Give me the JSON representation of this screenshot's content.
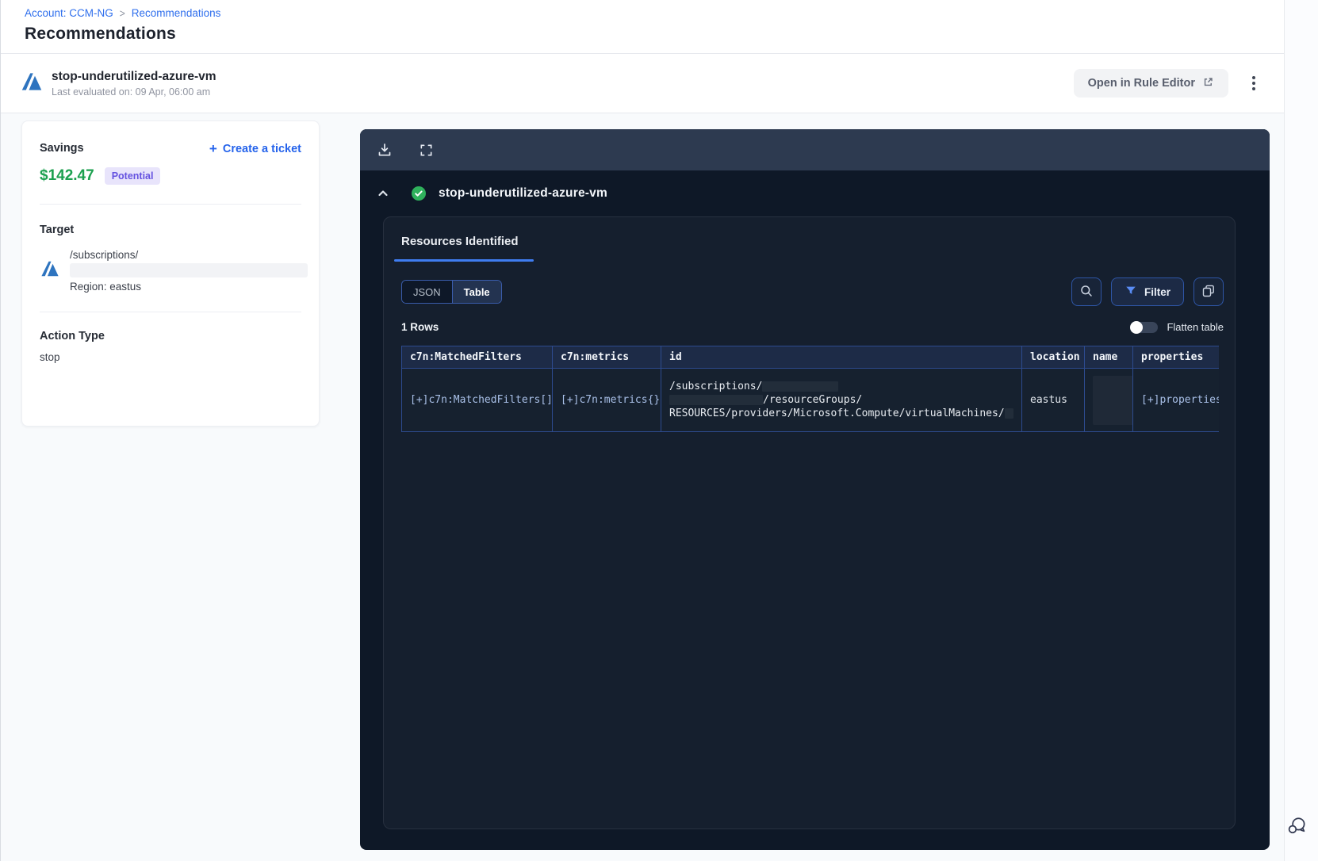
{
  "breadcrumb": {
    "account": "Account: CCM-NG",
    "separator": ">",
    "current": "Recommendations"
  },
  "page_title": "Recommendations",
  "header": {
    "rule_name": "stop-underutilized-azure-vm",
    "last_evaluated": "Last evaluated on: 09 Apr, 06:00 am",
    "open_in_rule_editor": "Open in Rule Editor"
  },
  "savings_card": {
    "savings_label": "Savings",
    "amount": "$142.47",
    "badge": "Potential",
    "plus_glyph": "+",
    "create_ticket": "Create a ticket",
    "target_label": "Target",
    "target_path": "/subscriptions/",
    "region": "Region: eastus",
    "action_type_label": "Action Type",
    "action_type_value": "stop"
  },
  "panel": {
    "rule_name": "stop-underutilized-azure-vm",
    "tab_label": "Resources Identified",
    "view_toggle": {
      "json_label": "JSON",
      "table_label": "Table",
      "selected": "Table"
    },
    "filter_label": "Filter",
    "rows_count": "1 Rows",
    "flatten_label": "Flatten table",
    "flatten_on": false,
    "table": {
      "columns": [
        "c7n:MatchedFilters",
        "c7n:metrics",
        "id",
        "location",
        "name",
        "properties"
      ],
      "rows": [
        {
          "matched_filters": "[+]c7n:MatchedFilters[]",
          "metrics": "[+]c7n:metrics{}",
          "id_line1": "/subscriptions/",
          "id_line2": "/resourceGroups/",
          "id_line3": "RESOURCES/providers/Microsoft.Compute/virtualMachines/",
          "location": "eastus",
          "name": "",
          "properties": "[+]properties"
        }
      ]
    }
  },
  "colors": {
    "accent_blue": "#2563eb",
    "savings_green": "#1ca04f",
    "badge_purple": "#6552e0",
    "panel_bg": "#0e1827",
    "panel_toolbar_bg": "#2d3a50",
    "table_border_blue": "#2d4b8f",
    "tab_underline_blue": "#3f7df0",
    "success_green": "#2fb15c"
  }
}
